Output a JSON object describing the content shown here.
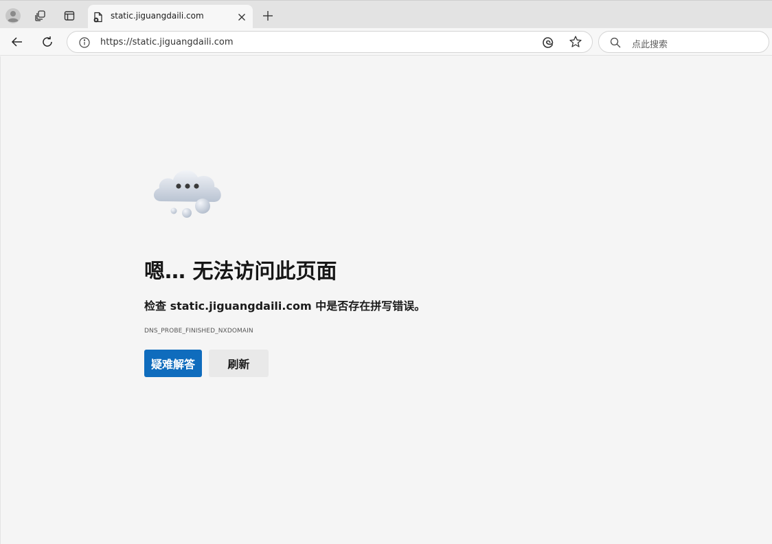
{
  "tab": {
    "title": "static.jiguangdaili.com",
    "favicon": "error-page-icon"
  },
  "toolbar": {
    "url": "https://static.jiguangdaili.com",
    "search_placeholder": "点此搜索"
  },
  "icons": {
    "profile": "profile-avatar-icon",
    "workspaces": "workspaces-icon",
    "tab_actions": "tab-actions-icon",
    "close_tab": "close-icon",
    "new_tab": "plus-icon",
    "back": "back-arrow-icon",
    "refresh": "refresh-icon",
    "site_info": "info-icon",
    "browser_essentials": "edge-icon",
    "favorite": "star-icon",
    "search": "search-icon",
    "illustration": "cloud-thinking-icon"
  },
  "error": {
    "heading": "嗯… 无法访问此页面",
    "message": "检查 static.jiguangdaili.com 中是否存在拼写错误。",
    "code": "DNS_PROBE_FINISHED_NXDOMAIN",
    "primary_button": "疑难解答",
    "secondary_button": "刷新"
  },
  "colors": {
    "accent": "#0f6cbd",
    "background": "#f5f5f5",
    "tabstrip": "#e3e3e3"
  }
}
